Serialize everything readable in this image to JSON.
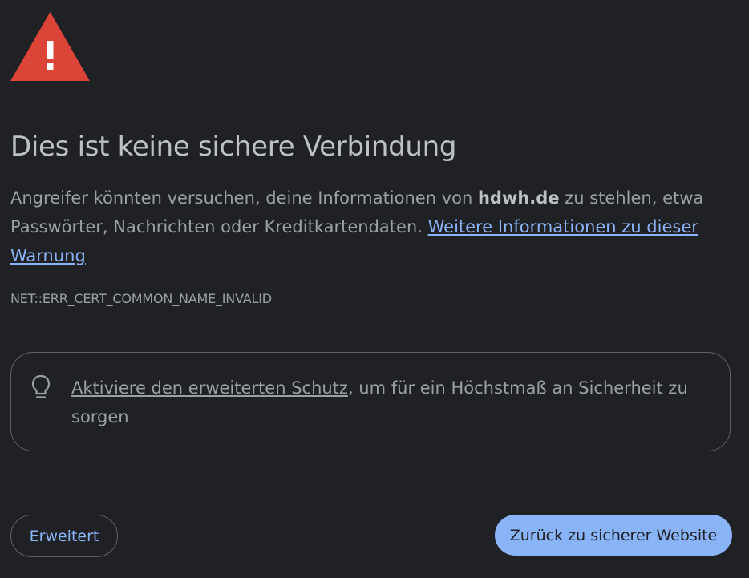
{
  "icons": {
    "warning": "warning-triangle-icon",
    "bulb": "lightbulb-icon"
  },
  "colors": {
    "background": "#202124",
    "warning_red": "#db4437",
    "link_blue": "#8ab4f8",
    "heading": "#bdc1c6",
    "text": "#9aa0a6",
    "border": "#5f6368"
  },
  "heading": "Dies ist keine sichere Verbindung",
  "message": {
    "prefix": "Angreifer könnten versuchen, deine Informationen von ",
    "domain": "hdwh.de",
    "suffix": " zu stehlen, etwa Passwörter, Nachrichten oder Kreditkartendaten. ",
    "link": "Weitere Informationen zu dieser Warnung"
  },
  "error_code": "NET::ERR_CERT_COMMON_NAME_INVALID",
  "protection": {
    "link": "Aktiviere den erweiterten Schutz",
    "text": ", um für ein Höchstmaß an Sicherheit zu sorgen"
  },
  "buttons": {
    "advanced": "Erweitert",
    "back": "Zurück zu sicherer Website"
  }
}
